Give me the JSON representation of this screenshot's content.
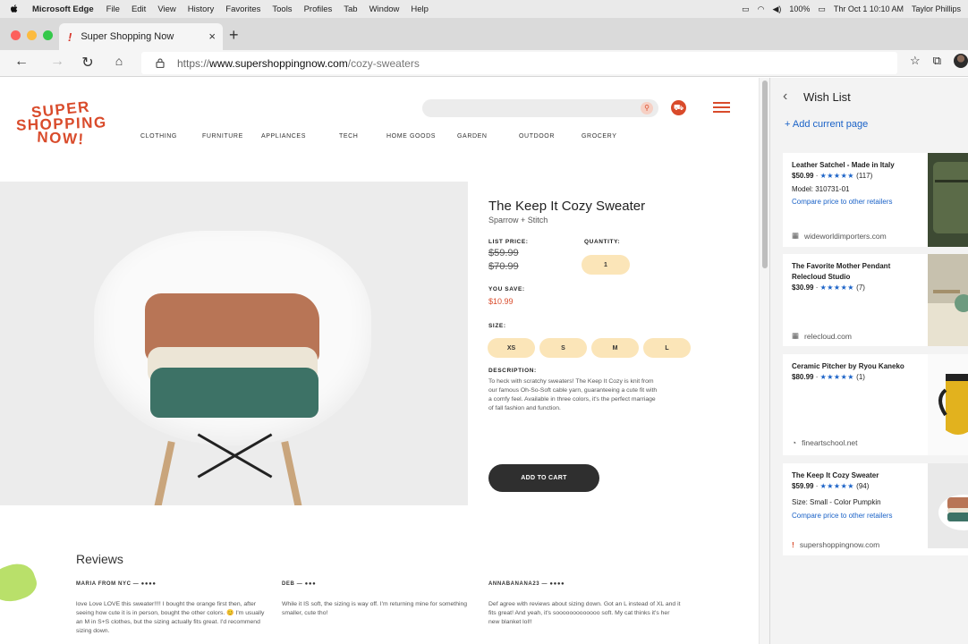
{
  "menubar": {
    "app": "Microsoft Edge",
    "items": [
      "File",
      "Edit",
      "View",
      "History",
      "Favorites",
      "Tools",
      "Profiles",
      "Tab",
      "Window",
      "Help"
    ],
    "battery": "100%",
    "datetime": "Thr Oct 1 10:10 AM",
    "user": "Taylor Phillips"
  },
  "tab": {
    "title": "Super Shopping Now",
    "favicon": "!",
    "close": "×",
    "new_tab": "+"
  },
  "address": {
    "scheme": "https://",
    "host": "www.supershoppingnow.com",
    "path": "/cozy-sweaters"
  },
  "site": {
    "logo": [
      "SUPER",
      "SHOPPING",
      "NOW!"
    ],
    "categories": [
      "CLOTHING",
      "FURNITURE",
      "APPLIANCES",
      "TECH",
      "HOME GOODS",
      "GARDEN",
      "OUTDOOR",
      "GROCERY"
    ]
  },
  "product": {
    "title": "The Keep It Cozy Sweater",
    "brand": "Sparrow + Stitch",
    "list_price_label": "LIST PRICE:",
    "price_old_1": "$59.99",
    "price_old_2": "$70.99",
    "quantity_label": "QUANTITY:",
    "quantity": "1",
    "you_save_label": "YOU SAVE:",
    "you_save": "$10.99",
    "size_label": "SIZE:",
    "sizes": [
      "XS",
      "S",
      "M",
      "L"
    ],
    "description_label": "DESCRIPTION:",
    "description": "To heck with scratchy sweaters! The Keep It Cozy is knit from our famous Oh-So-Soft cable yarn, guaranteeing a cute fit with a comfy feel. Available in three colors, it's the perfect marriage of fall fashion and function.",
    "add_to_cart": "ADD TO CART"
  },
  "reviews": {
    "title": "Reviews",
    "items": [
      {
        "author": "MARIA FROM NYC",
        "text": "love Love LOVE this sweater!!!! I bought the orange first then, after seeing how cute it is in person, bought the other colors. 😊 I'm usually an M in S+S clothes, but the sizing actually fits great. I'd recommend sizing down."
      },
      {
        "author": "DEB",
        "text": "While it IS soft, the sizing is way off. I'm returning mine for something smaller, cute tho!"
      },
      {
        "author": "ANNABANANA23",
        "text": "Def agree with reviews about sizing down. Got an L instead of XL and it fits great! And yeah, it's sooooooooooooo soft. My cat thinks it's her new blanket lol!!"
      }
    ]
  },
  "wishlist": {
    "title": "Wish List",
    "add_current": "+ Add current page",
    "items": [
      {
        "name": "Leather Satchel - Made in Italy",
        "price": "$50.99",
        "stars": "★★★★★",
        "count": "(117)",
        "extra": "Model: 310731-01",
        "link": "Compare price to other retailers",
        "source": "wideworldimporters.com"
      },
      {
        "name": "The Favorite Mother Pendant Relecloud Studio",
        "price": "$30.99",
        "stars": "★★★★★",
        "count": "(7)",
        "extra": "",
        "link": "",
        "source": "relecloud.com"
      },
      {
        "name": "Ceramic Pitcher by Ryou Kaneko",
        "price": "$80.99",
        "stars": "★★★★★",
        "count": "(1)",
        "extra": "",
        "link": "",
        "source": "fineartschool.net"
      },
      {
        "name": "The Keep It Cozy Sweater",
        "price": "$59.99",
        "stars": "★★★★★",
        "count": "(94)",
        "extra": "Size: Small - Color Pumpkin",
        "link": "Compare price to other retailers",
        "source": "supershoppingnow.com"
      }
    ]
  },
  "colors": {
    "brand": "#d94b2b",
    "link": "#1a62c7",
    "pill": "#fbe5b8"
  }
}
